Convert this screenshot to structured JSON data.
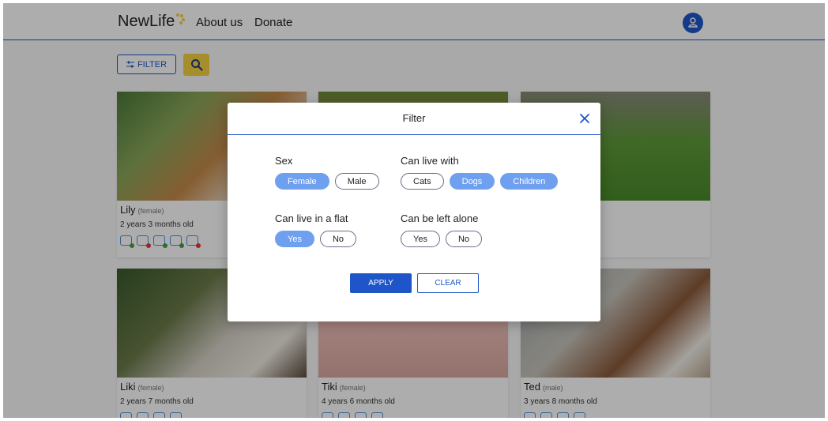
{
  "header": {
    "logo": "NewLife",
    "nav": [
      "About us",
      "Donate"
    ]
  },
  "toolbar": {
    "filter_label": "FILTER"
  },
  "cards": [
    {
      "name": "Lily",
      "sex": "(female)",
      "age": "2 years 3 months old"
    },
    {
      "name": "",
      "sex": "",
      "age": ""
    },
    {
      "name": "",
      "sex": "",
      "age": ""
    },
    {
      "name": "Liki",
      "sex": "(female)",
      "age": "2 years 7 months old"
    },
    {
      "name": "Tiki",
      "sex": "(female)",
      "age": "4 years 6 months old"
    },
    {
      "name": "Ted",
      "sex": "(male)",
      "age": "3 years 8 months old"
    }
  ],
  "modal": {
    "title": "Filter",
    "sex_label": "Sex",
    "sex_options": [
      "Female",
      "Male"
    ],
    "live_with_label": "Can live with",
    "live_with_options": [
      "Cats",
      "Dogs",
      "Children"
    ],
    "flat_label": "Can live in a flat",
    "flat_options": [
      "Yes",
      "No"
    ],
    "alone_label": "Can be left alone",
    "alone_options": [
      "Yes",
      "No"
    ],
    "apply_label": "APPLY",
    "clear_label": "CLEAR"
  },
  "colors": {
    "accent": "#1e56c9",
    "chip_selected": "#6fa0ef",
    "search_button": "#f5d142"
  }
}
